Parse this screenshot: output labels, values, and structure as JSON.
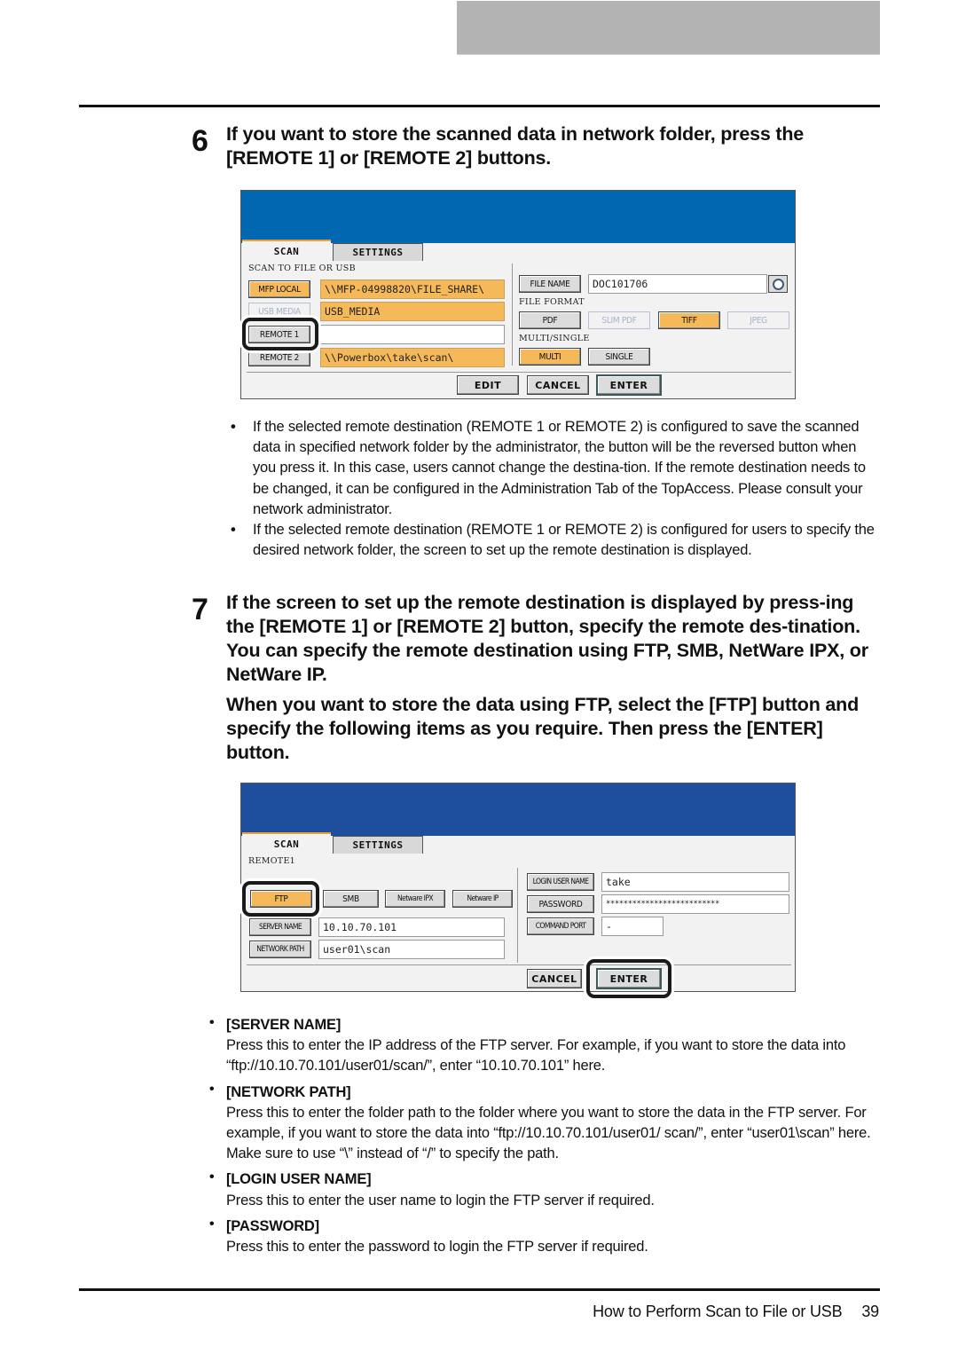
{
  "colors": {
    "panel1_header": "#0067b0",
    "panel2_header": "#1e4f9c",
    "selected_button": "#f5b95a",
    "header_block": "#b3b3b3"
  },
  "step6": {
    "number": "6",
    "title": "If you want to store the scanned data in network folder, press the [REMOTE 1] or [REMOTE 2] buttons.",
    "bullets": [
      "If the selected remote destination (REMOTE 1 or REMOTE 2) is configured to save the scanned data in specified network folder by the administrator, the button will be the reversed button when you press it.  In this case, users cannot change the destina-tion.  If the remote destination needs to be changed, it can be configured in the Administration Tab of the TopAccess.  Please consult your network administrator.",
      "If the selected remote destination (REMOTE 1 or REMOTE 2) is configured for users to specify the desired network folder, the screen to set up the remote destination is displayed."
    ]
  },
  "panel1": {
    "tabs": [
      "SCAN",
      "SETTINGS"
    ],
    "section_label": "SCAN TO FILE OR USB",
    "destinations": [
      {
        "button": "MFP LOCAL",
        "value": "\\\\MFP-04998820\\FILE_SHARE\\",
        "selected": true
      },
      {
        "button": "USB MEDIA",
        "value": "USB_MEDIA",
        "selected": false
      },
      {
        "button": "REMOTE 1",
        "value": "",
        "selected": false
      },
      {
        "button": "REMOTE 2",
        "value": "\\\\Powerbox\\take\\scan\\",
        "selected": false
      }
    ],
    "file_name_button": "FILE NAME",
    "file_name_value": "DOC101706",
    "clock_icon": "clock-icon",
    "file_format_label": "FILE FORMAT",
    "file_formats": [
      {
        "label": "PDF",
        "state": "normal"
      },
      {
        "label": "SLIM PDF",
        "state": "disabled"
      },
      {
        "label": "TIFF",
        "state": "selected"
      },
      {
        "label": "JPEG",
        "state": "disabled"
      }
    ],
    "multi_single_label": "MULTI/SINGLE",
    "multi_single": [
      {
        "label": "MULTI",
        "state": "selected"
      },
      {
        "label": "SINGLE",
        "state": "normal"
      }
    ],
    "footer_buttons": [
      "EDIT",
      "CANCEL",
      "ENTER"
    ]
  },
  "step7": {
    "number": "7",
    "title": "If the screen to set up the remote destination is displayed by press-ing the [REMOTE 1] or [REMOTE 2] button, specify the remote des-tination.  You can specify the remote destination using FTP, SMB, NetWare IPX, or NetWare IP.",
    "subtitle": "When you want to store the data using FTP, select the [FTP] button and specify the following items as you require. Then press the [ENTER] button."
  },
  "panel2": {
    "tabs": [
      "SCAN",
      "SETTINGS"
    ],
    "section_label": "REMOTE1",
    "protocols": [
      {
        "label": "FTP",
        "selected": true
      },
      {
        "label": "SMB",
        "selected": false
      },
      {
        "label": "Netware IPX",
        "selected": false
      },
      {
        "label": "Netware IP",
        "selected": false
      }
    ],
    "server_name_button": "SERVER NAME",
    "server_name_value": "10.10.70.101",
    "network_path_button": "NETWORK PATH",
    "network_path_value": "user01\\scan",
    "login_user_button": "LOGIN USER NAME",
    "login_user_value": "take",
    "password_button": "PASSWORD",
    "password_value": "**************************",
    "command_port_button": "COMMAND PORT",
    "command_port_value": "-",
    "footer_buttons": [
      "CANCEL",
      "ENTER"
    ]
  },
  "items": [
    {
      "heading": "[SERVER NAME]",
      "description": "Press this to enter the IP address of the FTP server.  For example, if you want to store the data into “ftp://10.10.70.101/user01/scan/”, enter “10.10.70.101” here."
    },
    {
      "heading": "[NETWORK PATH]",
      "description": "Press this to enter the folder path to the folder where you want to store the data in the FTP server.  For example, if you want to store the data into “ftp://10.10.70.101/user01/ scan/”, enter “user01\\scan” here.  Make sure to use “\\” instead of “/” to specify the path."
    },
    {
      "heading": "[LOGIN USER NAME]",
      "description": "Press this to enter the user name to login the FTP server if required."
    },
    {
      "heading": "[PASSWORD]",
      "description": "Press this to enter the password to login the FTP server if required."
    }
  ],
  "footer": {
    "section_title": "How to Perform Scan to File or USB",
    "page_number": "39"
  },
  "bullet_glyph": "•"
}
